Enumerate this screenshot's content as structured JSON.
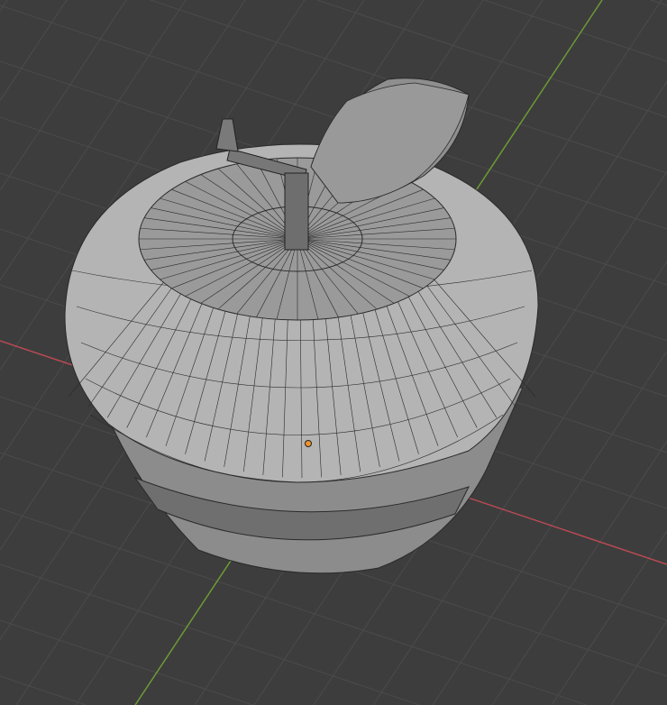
{
  "viewport": {
    "background_color": "#3d3d3d",
    "grid_color": "#4b4b4b",
    "x_axis_color": "#b84a54",
    "y_axis_color": "#6d9a35",
    "mesh_color": "#a8a8a8",
    "wire_color": "#2a2a2a",
    "origin_color": "#f0922a"
  },
  "object": {
    "icon": "apple-mesh",
    "origin_icon": "object-origin-dot"
  }
}
